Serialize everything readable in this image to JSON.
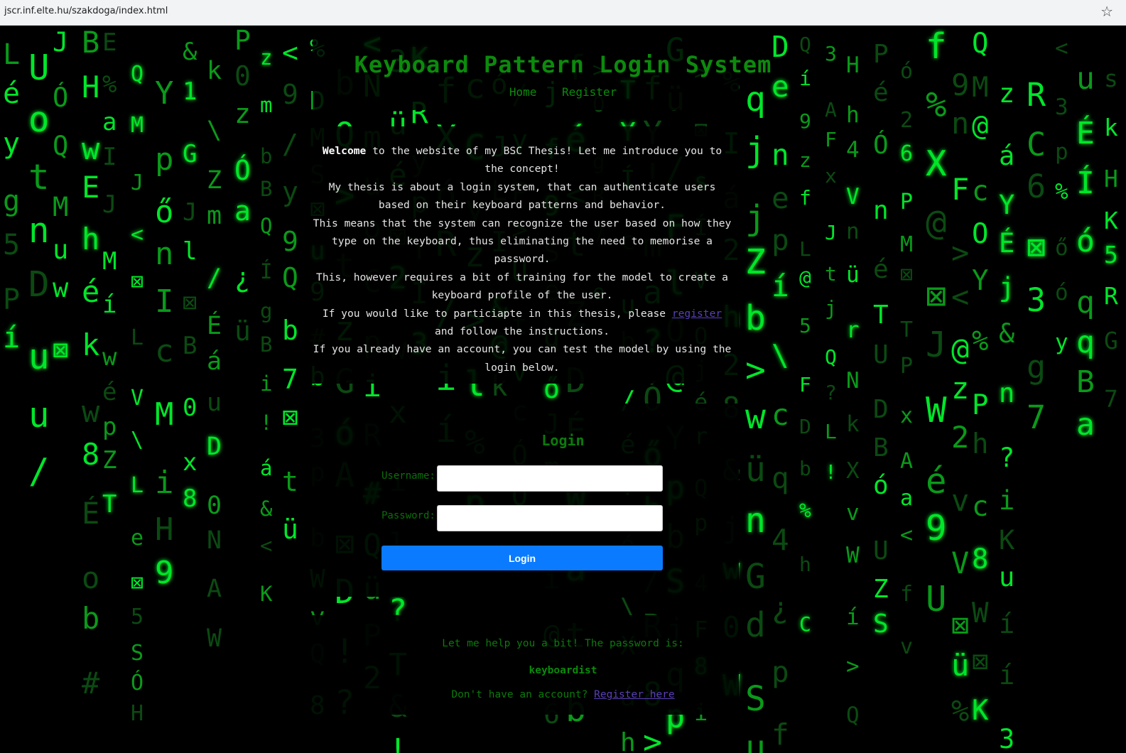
{
  "browser": {
    "url": "jscr.inf.elte.hu/szakdoga/index.html",
    "star_icon": "star-icon"
  },
  "header": {
    "title": "Keyboard Pattern Login System",
    "nav": [
      "Home",
      "Register"
    ]
  },
  "intro": {
    "welcome": "Welcome",
    "line1_rest": " to the website of my BSC Thesis! Let me introduce you to the concept!",
    "line2": "My thesis is about a login system, that can authenticate users based on their keyboard patterns and behavior.",
    "line3": "This means that the system can recognize the user based on how they type on the keyboard, thus eliminating the need to memorise a password.",
    "line4": "This, however requires a bit of training for the model to create a keyboard profile of the user.",
    "line5_before": "If you would like to particiapte in this thesis, please ",
    "line5_link": "register",
    "line5_after": " and follow the instructions.",
    "line6": "If you already have an account, you can test the model by using the login below."
  },
  "login": {
    "title": "Login",
    "username_label": "Username:",
    "password_label": "Password:",
    "username_value": "",
    "password_value": "",
    "button": "Login"
  },
  "help": {
    "hint": "Let me help you a bit! The password is:",
    "password": "keyboardist",
    "no_account": "Don't have an account? ",
    "register_link": "Register here"
  },
  "colors": {
    "matrix_green": "#00ff2a",
    "dim_green": "#0c8a0c",
    "button_blue": "#0a7bff"
  }
}
